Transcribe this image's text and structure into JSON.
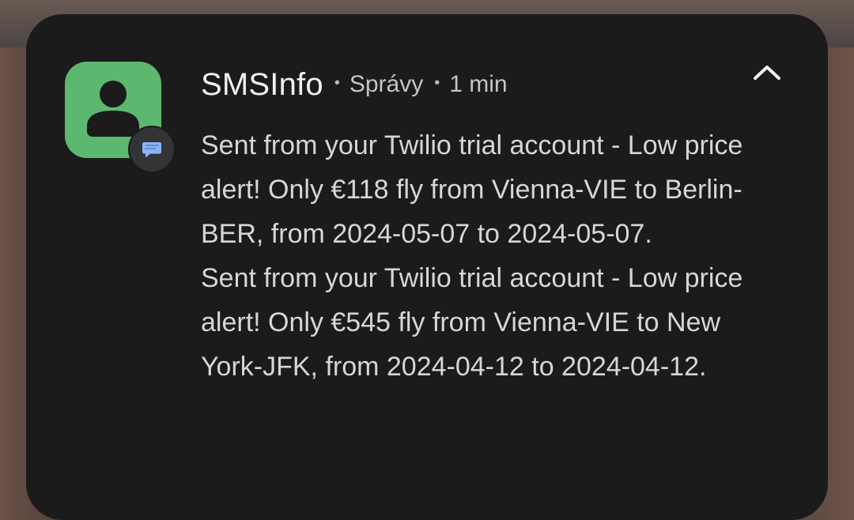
{
  "notification": {
    "app_name": "SMSInfo",
    "separator": "•",
    "category": "Správy",
    "time": "1 min",
    "colors": {
      "icon_background": "#5cb86f",
      "badge_background": "#323436",
      "badge_bubble": "#8ab4f8",
      "card_background": "#1b1b1b"
    },
    "icons": {
      "app": "contact-person-icon",
      "badge": "chat-bubble-icon",
      "collapse": "chevron-up-icon"
    },
    "messages": [
      {
        "text": "Sent from your Twilio trial account - Low price alert! Only €118 fly from Vienna-VIE to Berlin-BER, from 2024-05-07 to 2024-05-07."
      },
      {
        "text": "Sent from your Twilio trial account - Low price alert! Only €545 fly from Vienna-VIE to New York-JFK, from 2024-04-12 to 2024-04-12."
      }
    ]
  }
}
